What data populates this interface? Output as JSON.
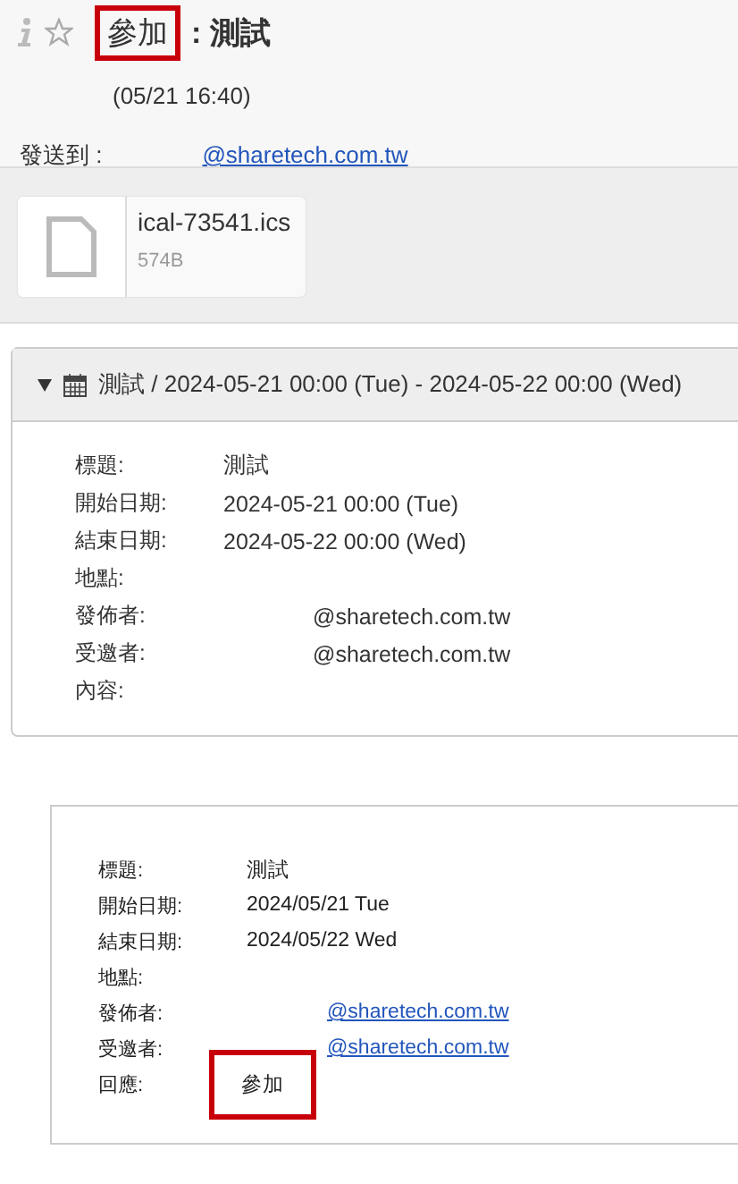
{
  "subject": {
    "response": "參加",
    "highlighted": true,
    "title": ": 測試"
  },
  "sender": {
    "time": "(05/21 16:40)"
  },
  "recipient": {
    "label": "發送到 :",
    "email": "@sharetech.com.tw"
  },
  "attachment": {
    "filename": "ical-73541.ics",
    "size": "574B"
  },
  "event": {
    "expanded": true,
    "summary": "測試 / 2024-05-21 00:00 (Tue) - 2024-05-22 00:00 (Wed)",
    "fields": [
      {
        "label": "標題:",
        "value": "測試",
        "kind": "text"
      },
      {
        "label": "開始日期:",
        "value": "2024-05-21 00:00 (Tue)",
        "kind": "text"
      },
      {
        "label": "結束日期:",
        "value": "2024-05-22 00:00 (Wed)",
        "kind": "text"
      },
      {
        "label": "地點:"
      },
      {
        "label": "發佈者:",
        "value": "@sharetech.com.tw",
        "kind": "email"
      },
      {
        "label": "受邀者:",
        "value": "@sharetech.com.tw",
        "kind": "email"
      },
      {
        "label": "內容:"
      }
    ]
  },
  "reply": {
    "fields": [
      {
        "label": "標題:",
        "value": "測試",
        "kind": "text"
      },
      {
        "label": "開始日期:",
        "value": "2024/05/21 Tue",
        "kind": "text"
      },
      {
        "label": "結束日期:",
        "value": "2024/05/22 Wed",
        "kind": "text"
      },
      {
        "label": "地點:"
      },
      {
        "label": "發佈者:",
        "value": "@sharetech.com.tw",
        "kind": "link"
      },
      {
        "label": "受邀者:",
        "value": "@sharetech.com.tw",
        "kind": "link"
      },
      {
        "label": "回應:",
        "value": "參加",
        "kind": "text",
        "highlighted": true
      }
    ]
  }
}
